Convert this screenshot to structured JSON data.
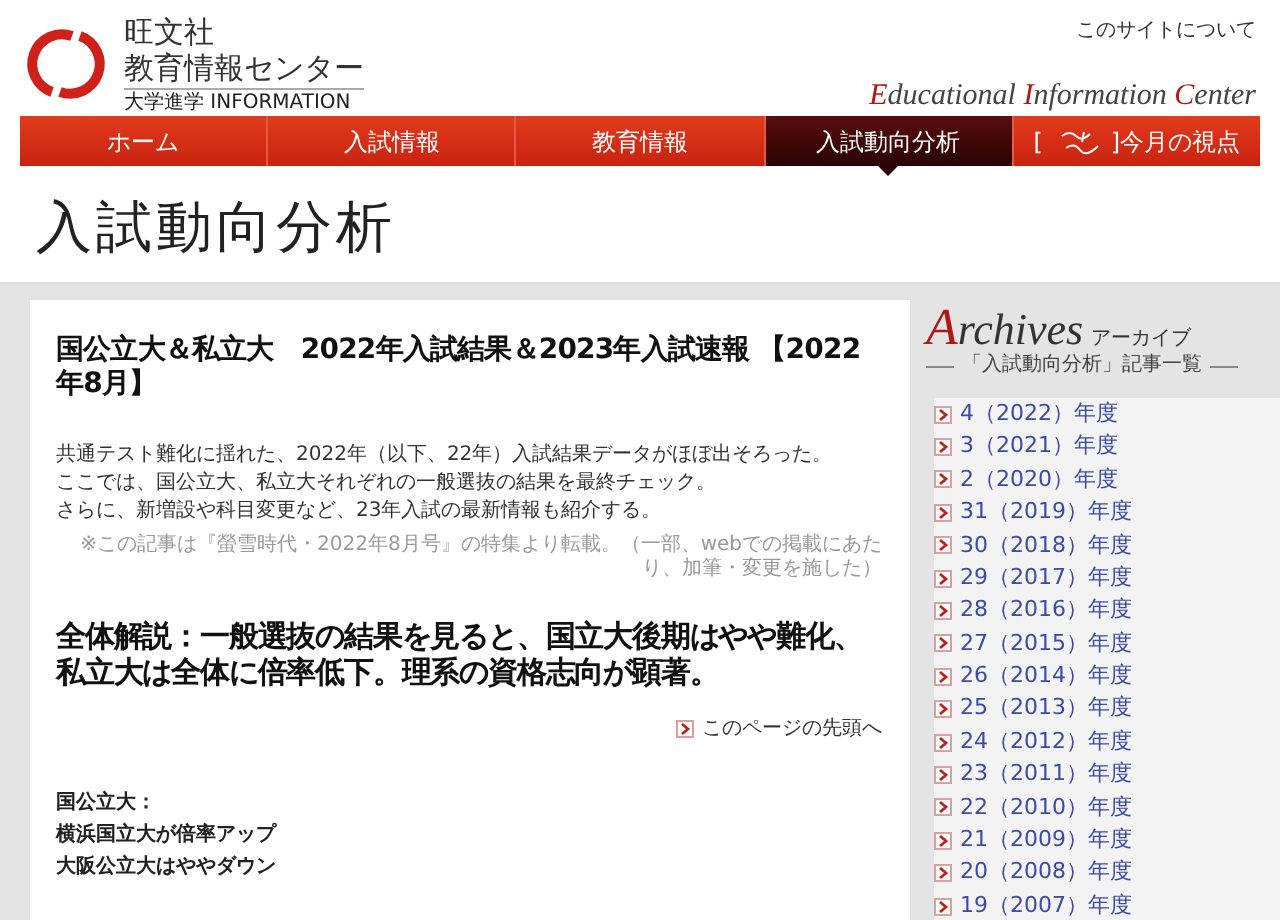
{
  "header": {
    "org": "旺文社",
    "center": "教育情報センター",
    "tagline": "大学進学 INFORMATION",
    "about_link": "このサイトについて",
    "english_name": [
      "Educational",
      "Information",
      "Center"
    ]
  },
  "nav": [
    {
      "label": "ホーム",
      "selected": false
    },
    {
      "label": "入試情報",
      "selected": false
    },
    {
      "label": "教育情報",
      "selected": false
    },
    {
      "label": "入試動向分析",
      "selected": true
    },
    {
      "label_before": "[",
      "label": "]今月の視点",
      "selected": false
    }
  ],
  "page_title": "入試動向分析",
  "article": {
    "title": "国公立大＆私立大　2022年入試結果＆2023年入試速報 【2022年8月】",
    "lead": [
      "共通テスト難化に揺れた、2022年（以下、22年）入試結果データがほぼ出そろった。",
      "ここでは、国公立大、私立大それぞれの一般選抜の結果を最終チェック。",
      "さらに、新増設や科目変更など、23年入試の最新情報も紹介する。"
    ],
    "note": "※この記事は『螢雪時代・2022年8月号』の特集より転載。（一部、webでの掲載にあたり、加筆・変更を施した）",
    "section_heading": "全体解説：一般選抜の結果を見ると、国立大後期はやや難化、私立大は全体に倍率低下。理系の資格志向が顕著。",
    "back_to_top": "このページの先頭へ",
    "subsection": [
      "国公立大：",
      "横浜国立大が倍率アップ",
      "大阪公立大はややダウン"
    ]
  },
  "sidebar": {
    "title": "Archives",
    "title_kana": "アーカイブ",
    "subtitle": "「入試動向分析」記事一覧",
    "items": [
      "4（2022）年度",
      "3（2021）年度",
      "2（2020）年度",
      "31（2019）年度",
      "30（2018）年度",
      "29（2017）年度",
      "28（2016）年度",
      "27（2015）年度",
      "26（2014）年度",
      "25（2013）年度",
      "24（2012）年度",
      "23（2011）年度",
      "22（2010）年度",
      "21（2009）年度",
      "20（2008）年度",
      "19（2007）年度"
    ]
  }
}
